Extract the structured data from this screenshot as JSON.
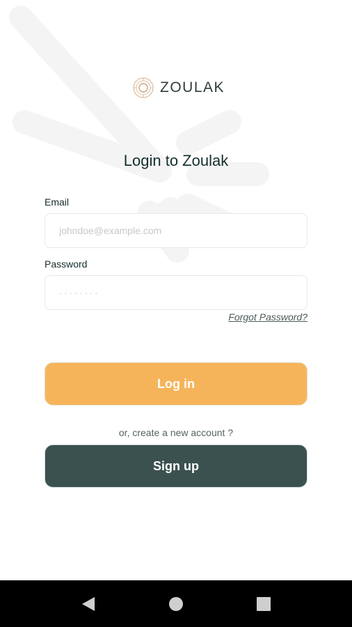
{
  "brand": {
    "name": "ZOULAK",
    "icon": "zoulak-logo-icon"
  },
  "page": {
    "title": "Login to Zoulak"
  },
  "form": {
    "email_label": "Email",
    "email_placeholder": "johndoe@example.com",
    "password_label": "Password",
    "password_value": "········",
    "forgot_label": "Forgot Password?"
  },
  "actions": {
    "login_label": "Log in",
    "alt_text": "or, create a new account ?",
    "signup_label": "Sign up"
  },
  "colors": {
    "accent": "#f6b45a",
    "primary_dark": "#3b5150",
    "heading": "#15302f"
  },
  "navbar": {
    "back_icon": "back-triangle-icon",
    "home_icon": "home-circle-icon",
    "recents_icon": "recents-square-icon"
  }
}
